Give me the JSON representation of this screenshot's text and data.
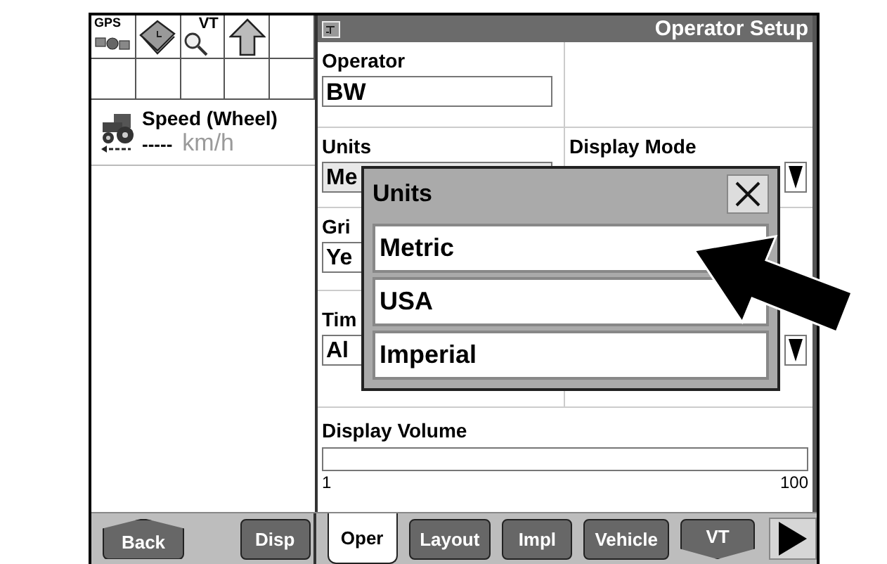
{
  "status_icons": [
    {
      "kind": "gps",
      "label": "GPS"
    },
    {
      "kind": "book"
    },
    {
      "kind": "vt",
      "label": "VT"
    },
    {
      "kind": "arrow"
    }
  ],
  "speed": {
    "label": "Speed (Wheel)",
    "value": "-----",
    "unit": "km/h"
  },
  "window": {
    "title": "Operator Setup"
  },
  "operator": {
    "label": "Operator",
    "value": "BW"
  },
  "rows": [
    {
      "label": "Units",
      "value": "Me",
      "right_label": "Display Mode",
      "right_dropdown": true
    },
    {
      "label": "Gri",
      "value": "Ye",
      "right_dropdown": false
    },
    {
      "label": "Tim",
      "value": "Al",
      "right_dropdown": true
    }
  ],
  "volume": {
    "label": "Display Volume",
    "level": 0,
    "min": "1",
    "max": "100"
  },
  "popup": {
    "title": "Units",
    "options": [
      {
        "label": "Metric",
        "selected": false
      },
      {
        "label": "USA",
        "selected": false
      },
      {
        "label": "Imperial",
        "selected": false
      }
    ]
  },
  "left_buttons": [
    {
      "label": "Back",
      "kind": "up"
    },
    {
      "label": "Disp",
      "kind": "plain"
    }
  ],
  "tabs": [
    {
      "label": "Oper",
      "kind": "tab",
      "selected": true
    },
    {
      "label": "Layout",
      "kind": "tab",
      "selected": false
    },
    {
      "label": "Impl",
      "kind": "tab",
      "selected": false
    },
    {
      "label": "Vehicle",
      "kind": "tab",
      "selected": false
    },
    {
      "label": "VT",
      "kind": "down",
      "selected": false
    }
  ]
}
